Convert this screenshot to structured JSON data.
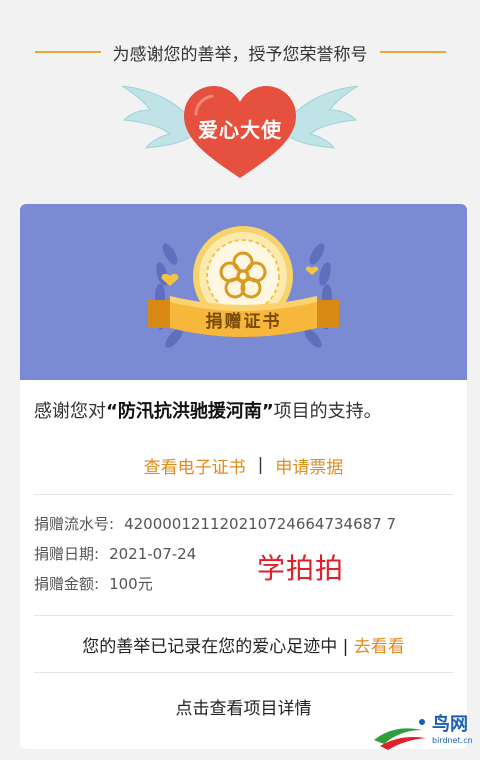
{
  "header": {
    "title": "为感谢您的善举，授予您荣誉称号",
    "badge_label": "爱心大使"
  },
  "certificate": {
    "ribbon_label": "捐赠证书"
  },
  "thanks": {
    "prefix": "感谢您对",
    "project": "“防汛抗洪驰援河南”",
    "suffix": "项目的支持。"
  },
  "links": {
    "view_certificate": "查看电子证书",
    "separator": "|",
    "apply_receipt": "申请票据"
  },
  "donation": {
    "serial_label": "捐赠流水号:",
    "serial_value": "420000121120210724664734687 7",
    "date_label": "捐赠日期:",
    "date_value": "2021-07-24",
    "amount_label": "捐赠金额:",
    "amount_value": "100元"
  },
  "watermark": "学拍拍",
  "footprint": {
    "text": "您的善举已记录在您的爱心足迹中",
    "separator": "|",
    "link": "去看看"
  },
  "detail_link": "点击查看项目详情",
  "site_logo": {
    "name": "鸟网",
    "url": "birdnet.cn"
  },
  "colors": {
    "accent_orange": "#e48a1a",
    "banner_blue": "#7a8bd3",
    "heart_red": "#e5503f",
    "watermark_red": "#e0202a"
  }
}
